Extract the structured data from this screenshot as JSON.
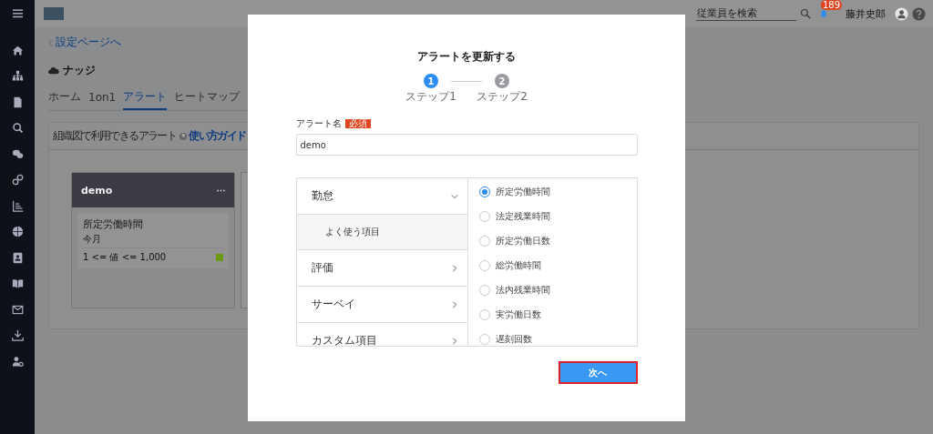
{
  "header": {
    "search": {
      "placeholder": "従業員を検索"
    },
    "notification_count": "189",
    "user_name": "藤井史郎"
  },
  "page": {
    "back_link": "設定ページへ",
    "title": "ナッジ",
    "tabs": [
      {
        "label": "ホーム",
        "selected": false
      },
      {
        "label": "1on1",
        "selected": false
      },
      {
        "label": "アラート",
        "selected": true
      },
      {
        "label": "ヒートマップ",
        "selected": false
      }
    ],
    "panel": {
      "title": "組織図で利用できるアラート",
      "guide_link": "使い方ガイド",
      "cards": [
        {
          "name": "demo",
          "alerts": [
            {
              "metric": "所定労働時間",
              "period": "今月",
              "condition": "1 <= 値 <= 1,000",
              "color": "#6b9a0a"
            }
          ]
        }
      ]
    }
  },
  "modal": {
    "title": "アラートを更新する",
    "steps": [
      {
        "number": "1",
        "label": "ステップ1",
        "selected": true
      },
      {
        "number": "2",
        "label": "ステップ2",
        "selected": false
      }
    ],
    "name_field": {
      "label": "アラート名",
      "required_badge": "必須",
      "value": "demo"
    },
    "categories": [
      {
        "label": "勤怠",
        "expanded": true,
        "children": [
          {
            "label": "よく使う項目",
            "selected": true
          }
        ]
      },
      {
        "label": "評価",
        "expanded": false
      },
      {
        "label": "サーベイ",
        "expanded": false
      },
      {
        "label": "カスタム項目",
        "expanded": false
      }
    ],
    "options": [
      {
        "label": "所定労働時間",
        "selected": true
      },
      {
        "label": "法定残業時間",
        "selected": false
      },
      {
        "label": "所定労働日数",
        "selected": false
      },
      {
        "label": "総労働時間",
        "selected": false
      },
      {
        "label": "法内残業時間",
        "selected": false
      },
      {
        "label": "実労働日数",
        "selected": false
      },
      {
        "label": "遅刻回数",
        "selected": false
      }
    ],
    "next_button": "次へ"
  }
}
